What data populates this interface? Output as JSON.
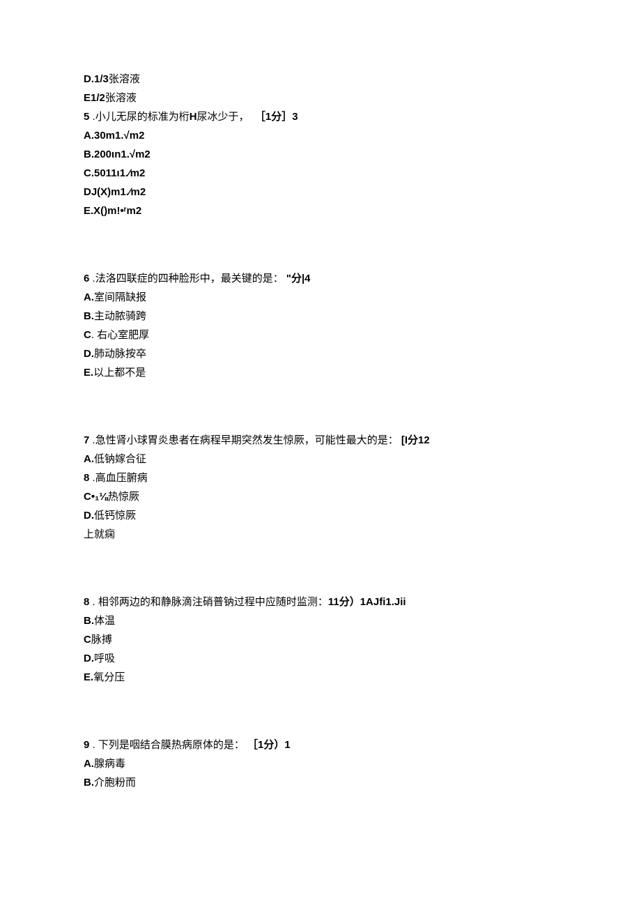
{
  "q_prev": {
    "option_d": {
      "label": "D.1/3",
      "text": "张溶液"
    },
    "option_e": {
      "label": "E1/2",
      "text": "张溶液"
    }
  },
  "q5": {
    "num": "5",
    "dot": " .",
    "text_pre": "小儿无尿的标准为桁",
    "bold_mid": "H",
    "text_post": "尿冰少于，",
    "score": "［1分］3",
    "a": {
      "label": "A.30m1.√m2"
    },
    "b": {
      "label": "B.200ιn1.√m2"
    },
    "c": {
      "label": "C.5011ι1.∕m2"
    },
    "d": {
      "label": "DJ(X)m1.∕m2"
    },
    "e": {
      "label": "E.X()m!•ʳm2"
    }
  },
  "q6": {
    "num": "6",
    "dot": " .",
    "text": "法洛四联症的四种脸形中，最关键的是：",
    "score": "\"分|4",
    "a": {
      "label": "A.",
      "text": "室间隔缺报"
    },
    "b": {
      "label": "B.",
      "text": "主动脓骑跨"
    },
    "c": {
      "label": "C",
      "text": ". 右心室肥厚"
    },
    "d": {
      "label": "D.",
      "text": "肺动脉按卒"
    },
    "e": {
      "label": "E.",
      "text": "以上都不是"
    }
  },
  "q7": {
    "num": "7",
    "dot": " .",
    "text": "急性肾小球胃炎患者在病程早期突然发生惊厥，可能性最大的是：",
    "score": "[I分12",
    "a": {
      "label": "A.",
      "text": "低钠嫁合征"
    },
    "b": {
      "label": "8",
      "dot": " .",
      "text": "高血压腑病"
    },
    "c": {
      "label": "C•₁⅛",
      "text": "热惊厥"
    },
    "d": {
      "label": "D.",
      "text": "低钙惊厥"
    },
    "e": {
      "text": "上就痫"
    }
  },
  "q8": {
    "num": "8",
    "dot": " .",
    "text": " 相邻两边的和静脉滴注硝普钠过程中应随时监测：",
    "score": "11分）1AJfi1.Jii",
    "b": {
      "label": "B.",
      "text": "体温"
    },
    "c": {
      "label": "C",
      "text": "脉搏"
    },
    "d": {
      "label": "D.",
      "text": "呼吸"
    },
    "e": {
      "label": "E.",
      "text": "氧分压"
    }
  },
  "q9": {
    "num": "9",
    "dot": " .",
    "text": " 下列是咽结合膜热病原体的是：",
    "score": "［1分）1",
    "a": {
      "label": "A.",
      "text": "腺病毒"
    },
    "b": {
      "label": "B.",
      "text": "介胞粉而"
    }
  }
}
